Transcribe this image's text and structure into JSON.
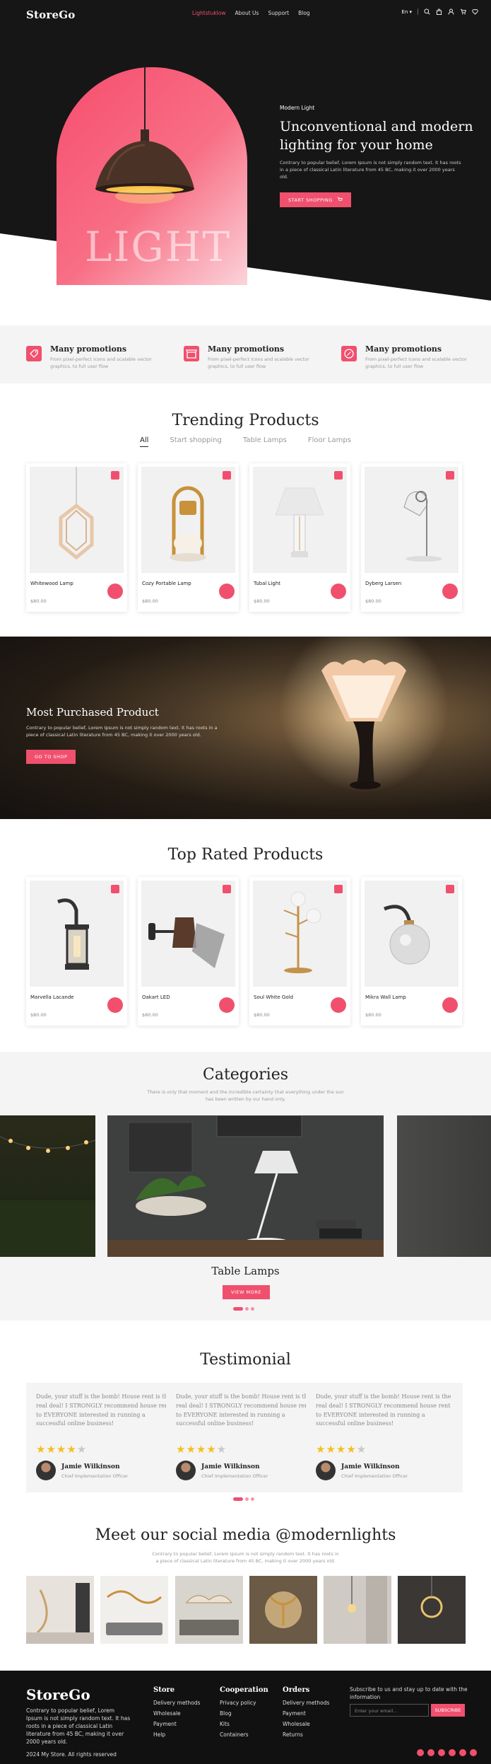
{
  "brand": {
    "name": "StoreGo",
    "accent": "#f0506e",
    "dark": "#161616"
  },
  "nav": {
    "links": [
      "Lightstuklow",
      "About Us",
      "Support",
      "Blog"
    ],
    "lang": "En",
    "icons": [
      "search-icon",
      "bag-icon",
      "user-icon",
      "cart-icon",
      "heart-icon"
    ]
  },
  "hero": {
    "subtitle": "Modern Light",
    "title": "Unconventional and modern lighting for your home",
    "description": "Contrary to popular belief, Lorem Ipsum is not simply random text. It has roots in a piece of classical Latin literature from 45 BC, making it over 2000 years old.",
    "cta": "START SHOPPING",
    "arch_word": "LIGHT"
  },
  "features": [
    {
      "title": "Many promotions",
      "description": "From pixel-perfect icons and scalable vector graphics, to full user flow",
      "icon": "tag-icon"
    },
    {
      "title": "Many promotions",
      "description": "From pixel-perfect icons and scalable vector graphics, to full user flow",
      "icon": "store-icon"
    },
    {
      "title": "Many promotions",
      "description": "From pixel-perfect icons and scalable vector graphics, to full user flow",
      "icon": "percent-icon"
    }
  ],
  "trending": {
    "title": "Trending Products",
    "tabs": [
      "All",
      "Start shopping",
      "Table Lamps",
      "Floor Lamps"
    ],
    "active_tab": "All",
    "products": [
      {
        "name": "Whitewood Lamp",
        "price": "$80.00"
      },
      {
        "name": "Cozy Portable Lamp",
        "price": "$80.00"
      },
      {
        "name": "Tubal Light",
        "price": "$80.00"
      },
      {
        "name": "Dyberg Larsen",
        "price": "$80.00"
      }
    ]
  },
  "banner": {
    "title": "Most Purchased Product",
    "description": "Contrary to popular belief, Lorem Ipsum is not simply random text. It has roots in a piece of classical Latin literature from 45 BC, making it over 2000 years old.",
    "cta": "GO TO SHOP"
  },
  "top_rated": {
    "title": "Top Rated Products",
    "products": [
      {
        "name": "Marvella Lacande",
        "price": "$80.00"
      },
      {
        "name": "Oakart LED",
        "price": "$80.00"
      },
      {
        "name": "Soul White Gold",
        "price": "$80.00"
      },
      {
        "name": "Mikra Wall Lamp",
        "price": "$80.00"
      }
    ]
  },
  "categories": {
    "title": "Categories",
    "description": "There is only that moment and the incredible certainty that everything under the sun has been written by our hand only.",
    "current": "Table Lamps",
    "cta": "VIEW MORE"
  },
  "testimonial": {
    "title": "Testimonial",
    "items": [
      {
        "quote": "Dude, your stuff is the bomb! House rent is the real deal! I STRONGLY recommend house rent to EVERYONE interested in running a successful online business!",
        "rating": 4,
        "name": "Jamie Wilkinson",
        "role": "Chief Implementation Officer"
      },
      {
        "quote": "Dude, your stuff is the bomb! House rent is the real deal! I STRONGLY recommend house rent to EVERYONE interested in running a successful online business!",
        "rating": 4,
        "name": "Jamie Wilkinson",
        "role": "Chief Implementation Officer"
      },
      {
        "quote": "Dude, your stuff is the bomb! House rent is the real deal! I STRONGLY recommend house rent to EVERYONE interested in running a successful online business!",
        "rating": 4,
        "name": "Jamie Wilkinson",
        "role": "Chief Implementation Officer"
      }
    ]
  },
  "social": {
    "title": "Meet our social media @modernlights",
    "description": "Contrary to popular belief, Lorem Ipsum is not simply random text. It has roots in a piece of classical Latin literature from 45 BC, making it over 2000 years old."
  },
  "footer": {
    "logo": "StoreGo",
    "description": "Contrary to popular belief, Lorem Ipsum is not simply random text. It has roots in a piece of classical Latin literature from 45 BC, making it over 2000 years old.",
    "columns": [
      {
        "title": "Store",
        "links": [
          "Delivery methods",
          "Wholesale",
          "Payment",
          "Help"
        ]
      },
      {
        "title": "Cooperation",
        "links": [
          "Privacy policy",
          "Blog",
          "Kits",
          "Containers"
        ]
      },
      {
        "title": "Orders",
        "links": [
          "Delivery methods",
          "Payment",
          "Wholesale",
          "Returns"
        ]
      }
    ],
    "subscribe_text": "Subscribe to us and stay up to date with the information",
    "email_placeholder": "Enter your email...",
    "subscribe_button": "SUBSCRIBE",
    "copyright": "2024 My Store. All rights reserved",
    "social_icons": [
      "facebook-icon",
      "twitter-icon",
      "instagram-icon",
      "youtube-icon",
      "pinterest-icon",
      "linkedin-icon"
    ]
  }
}
